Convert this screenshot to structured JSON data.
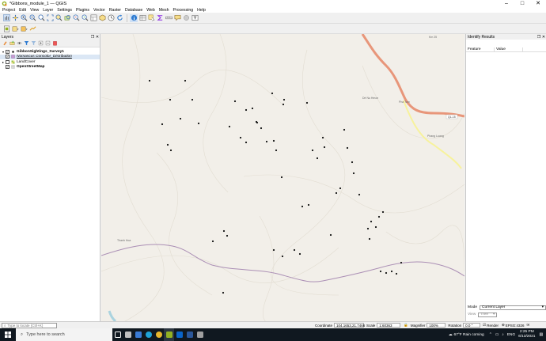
{
  "window": {
    "title": "*Gibbons_module_1 — QGIS",
    "controls": [
      "–",
      "□",
      "✕"
    ]
  },
  "menu": [
    "Project",
    "Edit",
    "View",
    "Layer",
    "Settings",
    "Plugins",
    "Vector",
    "Raster",
    "Database",
    "Web",
    "Mesh",
    "Processing",
    "Help"
  ],
  "layers_panel": {
    "title": "Layers",
    "layers": [
      {
        "name": "GibbonSightings_Survey1",
        "checked": true,
        "style": "bold",
        "expanded": true
      },
      {
        "name": "Nomascus Concolor_Distribution",
        "checked": true,
        "style": "italic-underline",
        "expanded": false
      },
      {
        "name": "LandCover",
        "checked": false,
        "style": "plain",
        "expanded": false
      },
      {
        "name": "OpenStreetMap",
        "checked": true,
        "style": "bold",
        "expanded": false
      }
    ]
  },
  "map": {
    "place_labels": [
      "Dé Nu Hmon",
      "Pha Tam",
      "Phang Luang",
      "Thanh Hoa",
      "Km 25"
    ],
    "road_label": "QL-15",
    "colors": {
      "background": "#f2efe9",
      "primary_road": "#e8967a",
      "secondary_road": "#f7f29c",
      "boundary": "#ab8fb5",
      "points": "#111111"
    }
  },
  "identify_panel": {
    "title": "Identify Results",
    "columns": [
      "Feature",
      "Value"
    ],
    "mode_label": "Mode",
    "mode_value": "Current Layer",
    "view_label": "View",
    "view_value": "Tree"
  },
  "statusbar": {
    "search_placeholder": "Type to locate (Ctrl+K)",
    "coordinate_label": "Coordinate",
    "coordinate_value": "104.1653,21.7466",
    "scale_label": "Scale",
    "scale_value": "1:60363",
    "magnifier_label": "Magnifier",
    "magnifier_value": "100%",
    "rotation_label": "Rotation",
    "rotation_value": "0.0 °",
    "render_label": "Render",
    "crs_value": "EPSG:4326"
  },
  "taskbar": {
    "search_placeholder": "Type here to search",
    "weather": "67°F  Rain coming",
    "lang": "ENG",
    "time": "2:25 PM",
    "date": "6/13/2021"
  }
}
